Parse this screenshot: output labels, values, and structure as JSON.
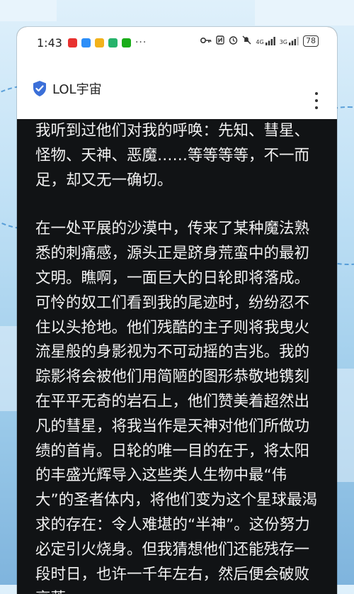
{
  "status_bar": {
    "time": "1:43",
    "more": "···",
    "network_1": "4G",
    "network_2": "3G",
    "battery": "78"
  },
  "app_bar": {
    "title": "LOL宇宙",
    "icon": "shield-check-icon",
    "menu_icon": "more-vertical-icon"
  },
  "colors": {
    "reader_background": "#111315",
    "reader_text": "#f2f2f2",
    "shield_blue": "#3b6fd8"
  },
  "article": {
    "paragraphs": [
      "我听到过他们对我的呼唤：先知、彗星、怪物、天神、恶魔……等等等等，不一而足，却又无一确切。",
      "在一处平展的沙漠中，传来了某种魔法熟悉的刺痛感，源头正是跻身荒蛮中的最初文明。瞧啊，一面巨大的日轮即将落成。可怜的奴工们看到我的尾迹时，纷纷忍不住以头抢地。他们残酷的主子则将我曳火流星般的身影视为不可动摇的吉兆。我的踪影将会被他们用简陋的图形恭敬地镌刻在平平无奇的岩石上，他们赞美着超然出凡的彗星，将我当作是天神对他们所做功绩的首肯。日轮的唯一目的在于，将太阳的丰盛光辉导入这些类人生物中最“伟大”的圣者体内，将他们变为这个星球最渴求的存在：令人难堪的“半神”。这份努力必定引火烧身。但我猜想他们还能残存一段时日，也许一千年左右，然后便会破败衰落，"
    ]
  }
}
